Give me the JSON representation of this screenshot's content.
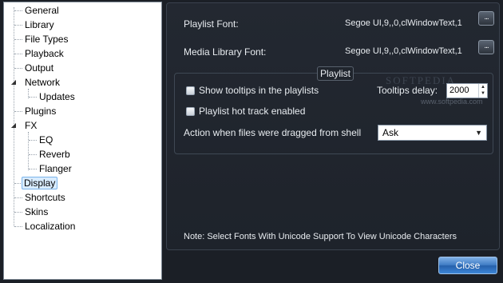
{
  "tree": {
    "items": [
      {
        "label": "General"
      },
      {
        "label": "Library"
      },
      {
        "label": "File Types"
      },
      {
        "label": "Playback"
      },
      {
        "label": "Output"
      },
      {
        "label": "Network"
      },
      {
        "label": "Updates"
      },
      {
        "label": "Plugins"
      },
      {
        "label": "FX"
      },
      {
        "label": "EQ"
      },
      {
        "label": "Reverb"
      },
      {
        "label": "Flanger"
      },
      {
        "label": "Display"
      },
      {
        "label": "Shortcuts"
      },
      {
        "label": "Skins"
      },
      {
        "label": "Localization"
      }
    ],
    "selected": "Display"
  },
  "fonts": {
    "playlist_label": "Playlist Font:",
    "playlist_value": "Segoe UI,9,,0,clWindowText,1",
    "library_label": "Media Library Font:",
    "library_value": "Segoe UI,9,,0,clWindowText,1",
    "browse_label": "..."
  },
  "playlist_group": {
    "title": "Playlist",
    "show_tooltips_label": "Show tooltips in the playlists",
    "show_tooltips_checked": false,
    "hot_track_label": "Playlist hot track enabled",
    "hot_track_checked": false,
    "tooltips_delay_label": "Tooltips delay:",
    "tooltips_delay_value": "2000",
    "drag_action_label": "Action when files were dragged from shell",
    "drag_action_value": "Ask"
  },
  "watermark": {
    "text": "SOFTPEDIA",
    "url": "www.softpedia.com"
  },
  "note": "Note: Select Fonts With Unicode Support To View Unicode Characters",
  "close_label": "Close",
  "colors": {
    "accent": "#3f7cc4",
    "background": "#1b1f26"
  }
}
